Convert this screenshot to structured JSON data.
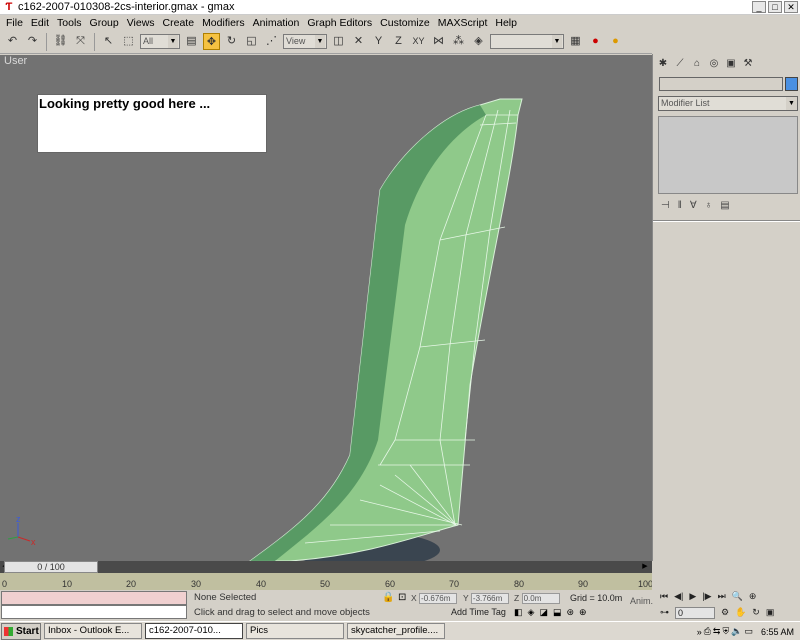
{
  "window": {
    "title": "c162-2007-010308-2cs-interior.gmax - gmax"
  },
  "menubar": [
    "File",
    "Edit",
    "Tools",
    "Group",
    "Views",
    "Create",
    "Modifiers",
    "Animation",
    "Graph Editors",
    "Customize",
    "MAXScript",
    "Help"
  ],
  "toolbar": {
    "selection_filter": "All",
    "reference_coord": "View",
    "named_selection": ""
  },
  "viewport": {
    "label": "User",
    "note": "Looking pretty good here ...",
    "axis_z": "z",
    "axis_x": "x"
  },
  "command_panel": {
    "object_name": "",
    "modifier_list": "Modifier List",
    "color": "#4a90e2"
  },
  "time_slider": {
    "label": "0 / 100"
  },
  "ruler": {
    "ticks": [
      "0",
      "10",
      "20",
      "30",
      "40",
      "50",
      "60",
      "70",
      "80",
      "90",
      "100"
    ]
  },
  "status": {
    "selection": "None Selected",
    "prompt": "Click and drag to select and move objects",
    "x": "-0.676m",
    "y": "-3.766m",
    "z": "0.0m",
    "x_label": "X",
    "y_label": "Y",
    "z_label": "Z",
    "grid": "Grid = 10.0m",
    "add_time_tag": "Add Time Tag",
    "anim": "Anim."
  },
  "right_controls": {
    "frame": "0"
  },
  "taskbar": {
    "start": "Start",
    "tasks": [
      "Inbox - Outlook E...",
      "c162-2007-010...",
      "Pics",
      "skycatcher_profile...."
    ],
    "clock": "6:55 AM"
  }
}
